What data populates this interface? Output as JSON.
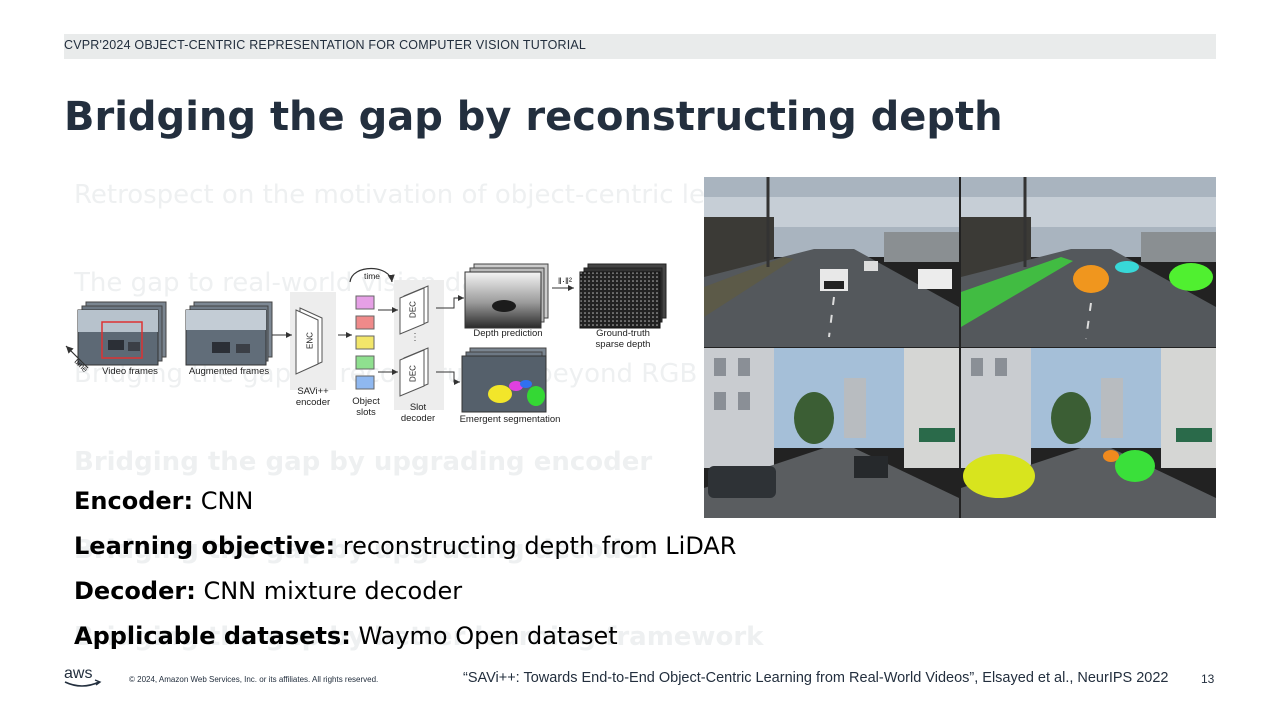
{
  "header": {
    "tutorial": "CVPR'2024 OBJECT-CENTRIC REPRESENTATION FOR COMPUTER VISION TUTORIAL"
  },
  "title": "Bridging the gap by reconstructing depth",
  "ghost_agenda": {
    "title_ghost": "Bridging",
    "items": [
      "Retrospect on the motivation of object-centric learning",
      "The gap to real-world vision data",
      "Bridging the gap by reconstructing beyond RGB pixel values",
      "Bridging the gap by upgrading encoder",
      "Bridging the gap by upgrading decoder",
      "Bridging the gap by better learning framework"
    ]
  },
  "diagram": {
    "labels": {
      "video_frames": "Video frames",
      "augmented_frames": "Augmented frames",
      "time_axis": "time",
      "time_loop": "time",
      "enc": "ENC",
      "encoder": "SAVi++\nencoder",
      "object_slots": "Object\nslots",
      "dec": "DEC",
      "slot_decoder": "Slot\ndecoder",
      "depth_prediction": "Depth prediction",
      "loss": "‖·‖²",
      "ground_truth": "Ground-truth\nsparse depth",
      "emergent_segmentation": "Emergent segmentation"
    },
    "slot_colors": [
      "#e6a0e6",
      "#ef8a8a",
      "#f2e66a",
      "#8fe08f",
      "#8fb8f0"
    ]
  },
  "bullets": [
    {
      "key": "Encoder:",
      "value": " CNN"
    },
    {
      "key": "Learning objective:",
      "value": " reconstructing depth from LiDAR"
    },
    {
      "key": "Decoder:",
      "value": " CNN mixture decoder"
    },
    {
      "key": "Applicable datasets:",
      "value": " Waymo Open dataset"
    }
  ],
  "footer": {
    "logo": "aws",
    "copyright": "© 2024, Amazon Web Services, Inc. or its affiliates. All rights reserved.",
    "citation_title": "“SAVi++: Towards End-to-End Object-Centric Learning from Real-World Videos”",
    "citation_rest": ", Elsayed et al., NeurIPS 2022",
    "page": "13"
  }
}
